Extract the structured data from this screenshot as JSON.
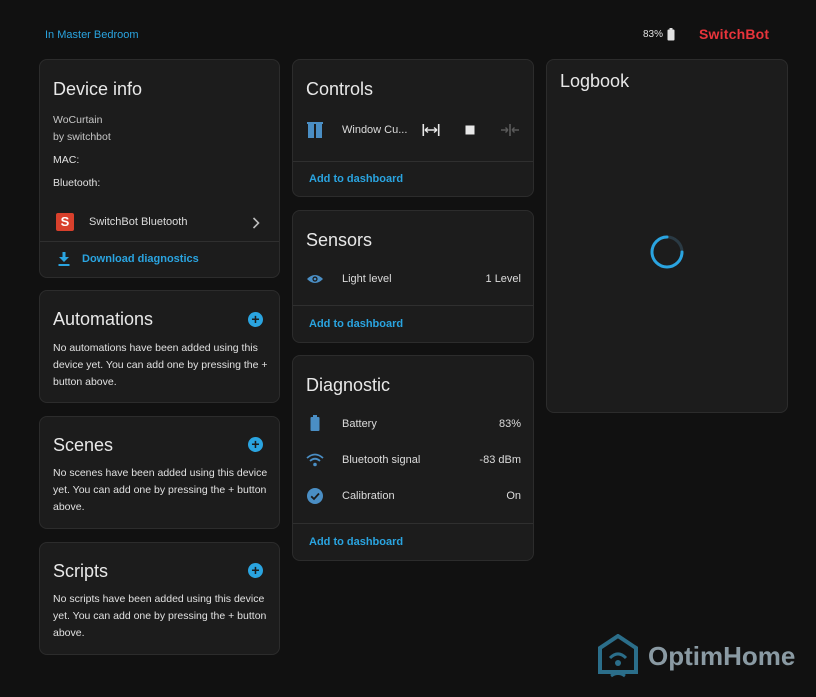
{
  "header": {
    "breadcrumb": "In Master Bedroom",
    "battery": "83%",
    "brand": "SwitchBot"
  },
  "device_info": {
    "title": "Device info",
    "model": "WoCurtain",
    "manufacturer": "by switchbot",
    "mac_label": "MAC:",
    "bluetooth_label": "Bluetooth:",
    "integration": "SwitchBot Bluetooth",
    "download": "Download diagnostics"
  },
  "automations": {
    "title": "Automations",
    "text": "No automations have been added using this device yet. You can add one by pressing the + button above."
  },
  "scenes": {
    "title": "Scenes",
    "text": "No scenes have been added using this device yet. You can add one by pressing the + button above."
  },
  "scripts": {
    "title": "Scripts",
    "text": "No scripts have been added using this device yet. You can add one by pressing the + button above."
  },
  "controls": {
    "title": "Controls",
    "entity": "Window Cu...",
    "add_label": "Add to dashboard"
  },
  "sensors": {
    "title": "Sensors",
    "light_label": "Light level",
    "light_value": "1 Level",
    "add_label": "Add to dashboard"
  },
  "diagnostic": {
    "title": "Diagnostic",
    "rows": [
      {
        "label": "Battery",
        "value": "83%"
      },
      {
        "label": "Bluetooth signal",
        "value": "-83 dBm"
      },
      {
        "label": "Calibration",
        "value": "On"
      }
    ],
    "add_label": "Add to dashboard"
  },
  "logbook": {
    "title": "Logbook"
  },
  "watermark": {
    "text": "OptimHome"
  },
  "colors": {
    "accent": "#2aa4e0",
    "brand": "#e8343b",
    "card": "#1c1c1c",
    "background": "#111111",
    "icon_blue": "#4a8ec4"
  }
}
